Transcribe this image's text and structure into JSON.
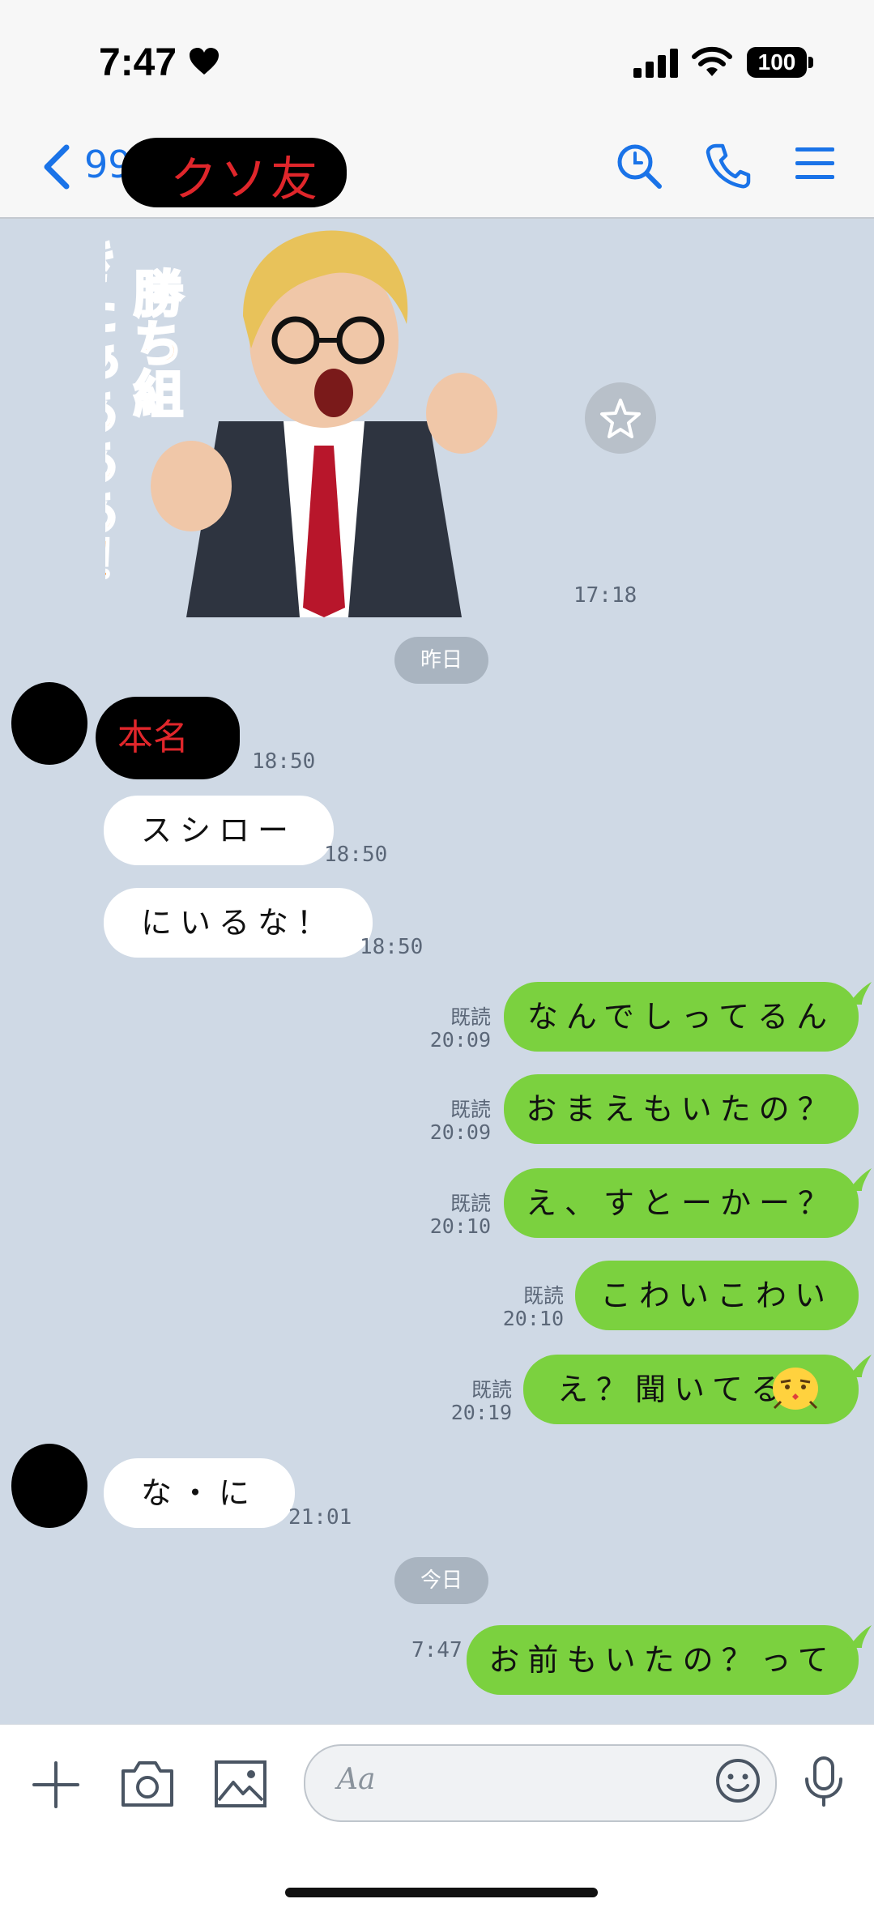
{
  "status_bar": {
    "time": "7:47",
    "battery": "100"
  },
  "header": {
    "unread_count": "99+",
    "chat_name": "クソ友"
  },
  "messages": {
    "sticker_time": "17:18",
    "date_yesterday": "昨日",
    "msg1_text": "本名",
    "msg1_time": "18:50",
    "msg2_text": "スシロー",
    "msg2_time": "18:50",
    "msg3_text": "にいるな！",
    "msg3_time": "18:50",
    "msg4_text": "なんでしってるん",
    "msg4_read": "既読",
    "msg4_time": "20:09",
    "msg5_text": "おまえもいたの？",
    "msg5_read": "既読",
    "msg5_time": "20:09",
    "msg6_text": "え、すとーかー？",
    "msg6_read": "既読",
    "msg6_time": "20:10",
    "msg7_text": "こわいこわい",
    "msg7_read": "既読",
    "msg7_time": "20:10",
    "msg8_text": "え？聞いてる",
    "msg8_read": "既読",
    "msg8_time": "20:19",
    "msg9_text": "な・に",
    "msg9_time": "21:01",
    "date_today": "今日",
    "msg10_text": "お前もいたの？って",
    "msg10_time": "7:47"
  },
  "sticker": {
    "caption_col1": "勝ち組",
    "caption_col2": "きたぁあああ！"
  },
  "input": {
    "placeholder": "Aa"
  },
  "colors": {
    "chat_bg": "#cfd9e5",
    "outgoing_bubble": "#7bd13f",
    "accent_blue": "#1a73e8",
    "sticker_text": "#ff8a1c"
  }
}
